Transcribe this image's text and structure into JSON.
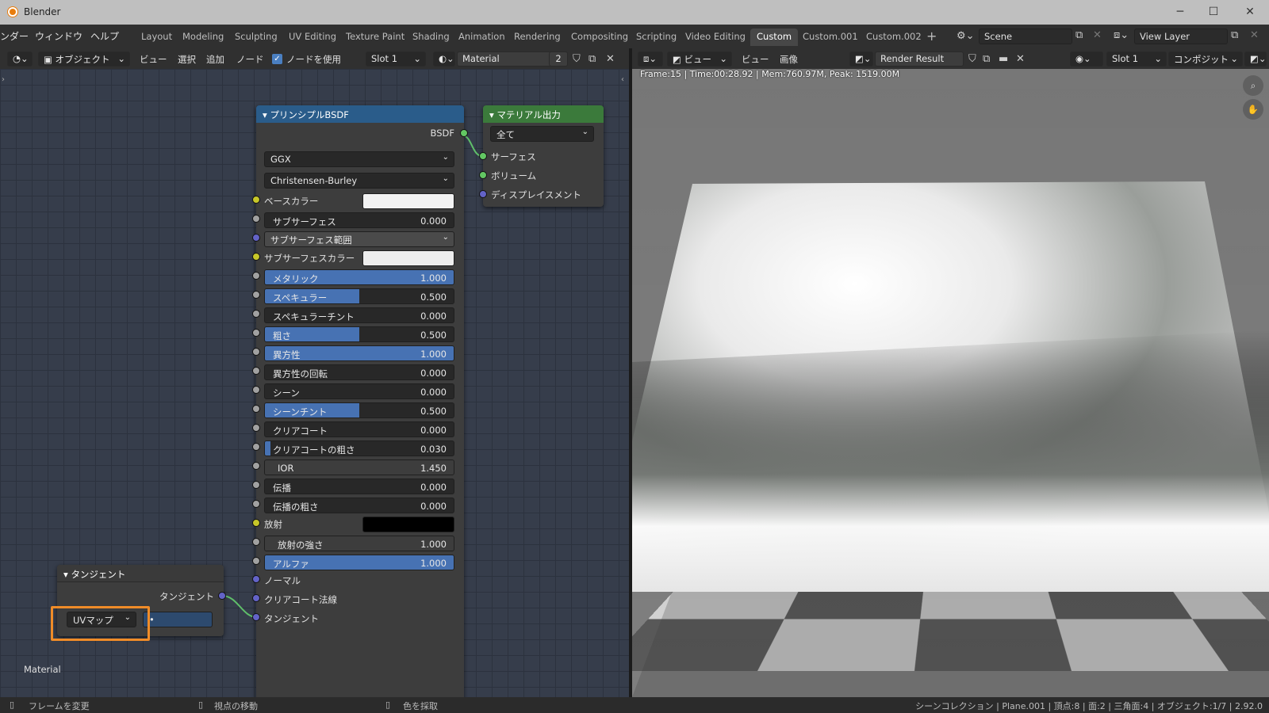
{
  "window": {
    "title": "Blender",
    "minimize": "─",
    "maximize": "☐",
    "close": "✕"
  },
  "menus": [
    "ンダー",
    "ウィンドウ",
    "ヘルプ"
  ],
  "workspaces": [
    "Layout",
    "Modeling",
    "Sculpting",
    "UV Editing",
    "Texture Paint",
    "Shading",
    "Animation",
    "Rendering",
    "Compositing",
    "Scripting",
    "Video Editing",
    "Custom",
    "Custom.001",
    "Custom.002"
  ],
  "active_workspace": "Custom",
  "scene": "Scene",
  "view_layer": "View Layer",
  "node_header": {
    "mode": "オブジェクト",
    "view": "ビュー",
    "select": "選択",
    "add": "追加",
    "node": "ノード",
    "use_nodes": "ノードを使用",
    "slot": "Slot 1",
    "material": "Material",
    "users": "2"
  },
  "image_header": {
    "view": "ビュー",
    "view2": "ビュー",
    "image": "画像",
    "image_name": "Render Result",
    "slot": "Slot 1",
    "composite": "コンポジット"
  },
  "render_info": "Frame:15 | Time:00:28.92 | Mem:760.97M, Peak: 1519.00M",
  "material_label": "Material",
  "bsdf_node": {
    "title": "プリンシプルBSDF",
    "output": "BSDF",
    "distribution": "GGX",
    "subsurface_method": "Christensen-Burley",
    "base_color": {
      "label": "ベースカラー",
      "color": "#f2f2f2"
    },
    "subsurface": {
      "label": "サブサーフェス",
      "value": "0.000",
      "fraction": 0
    },
    "subsurface_radius": "サブサーフェス範囲",
    "subsurface_color": {
      "label": "サブサーフェスカラー",
      "color": "#ededed"
    },
    "sliders": [
      {
        "label": "メタリック",
        "value": "1.000",
        "fraction": 1
      },
      {
        "label": "スペキュラー",
        "value": "0.500",
        "fraction": 0.5
      },
      {
        "label": "スペキュラーチント",
        "value": "0.000",
        "fraction": 0
      },
      {
        "label": "粗さ",
        "value": "0.500",
        "fraction": 0.5
      },
      {
        "label": "異方性",
        "value": "1.000",
        "fraction": 1
      },
      {
        "label": "異方性の回転",
        "value": "0.000",
        "fraction": 0
      },
      {
        "label": "シーン",
        "value": "0.000",
        "fraction": 0
      },
      {
        "label": "シーンチント",
        "value": "0.500",
        "fraction": 0.5
      },
      {
        "label": "クリアコート",
        "value": "0.000",
        "fraction": 0
      },
      {
        "label": "クリアコートの粗さ",
        "value": "0.030",
        "fraction": 0.03
      },
      {
        "label": "IOR",
        "value": "1.450",
        "fraction": 1
      },
      {
        "label": "伝播",
        "value": "0.000",
        "fraction": 0
      },
      {
        "label": "伝播の粗さ",
        "value": "0.000",
        "fraction": 0
      }
    ],
    "emission": {
      "label": "放射",
      "color": "#000000"
    },
    "emission_strength": {
      "label": "放射の強さ",
      "value": "1.000",
      "fraction": 1
    },
    "alpha": {
      "label": "アルファ",
      "value": "1.000",
      "fraction": 1
    },
    "normal": "ノーマル",
    "clearcoat_normal": "クリアコート法線",
    "tangent": "タンジェント"
  },
  "output_node": {
    "title": "マテリアル出力",
    "target": "全て",
    "surface": "サーフェス",
    "volume": "ボリューム",
    "displacement": "ディスプレイスメント"
  },
  "tangent_node": {
    "title": "タンジェント",
    "output": "タンジェント",
    "direction": "UVマップ",
    "uv_map": "•"
  },
  "status": {
    "left1": "フレームを変更",
    "left2": "視点の移動",
    "left3": "色を採取",
    "right": "シーンコレクション | Plane.001 | 頂点:8 | 面:2 | 三角面:4 | オブジェクト:1/7 | 2.92.0"
  },
  "colors": {
    "bsdf_header": "#2a5c8a",
    "output_header": "#3b7a3b",
    "tangent_header": "#3d3d3d",
    "accent": "#4772b3",
    "highlight": "#f08c28"
  }
}
